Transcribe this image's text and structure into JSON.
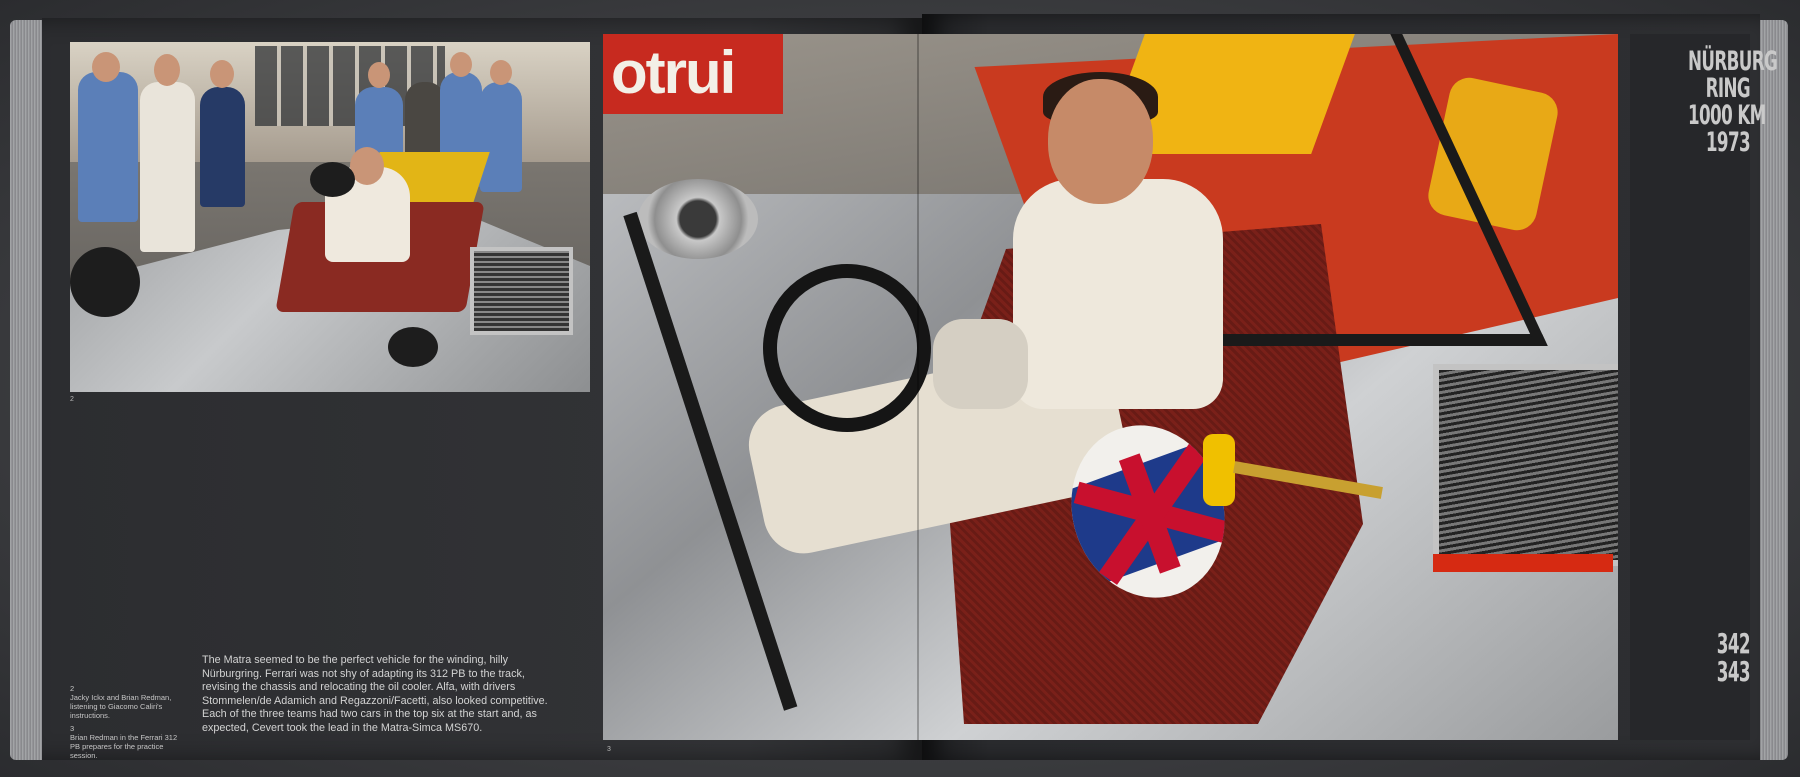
{
  "left_page": {
    "photo_number": "2",
    "captions": [
      {
        "number": "2",
        "text": "Jacky Ickx and Brian Redman, listening to Giacomo Caliri's instructions."
      },
      {
        "number": "3",
        "text": "Brian Redman in the Ferrari 312 PB prepares for the practice session."
      }
    ],
    "body_text": "The Matra seemed to be the perfect vehicle for the winding, hilly Nürburgring. Ferrari was not shy of adapting its 312 PB to the track, revising the chassis and relocating the oil cooler. Alfa, with drivers Stommelen/de Adamich and Regazzoni/Facetti, also looked competitive. Each of the three teams had two cars in the top six at the start and, as expected, Cevert took the lead in the Matra-Simca MS670."
  },
  "spread_photo": {
    "photo_number": "3",
    "sign_text": "otrui"
  },
  "right_page": {
    "chapter_title_lines": [
      "NÜRBURG",
      "RING",
      "1000 KM",
      "1973"
    ],
    "page_numbers": [
      "342",
      "343"
    ]
  },
  "colors": {
    "page_dark": "#2e2f32",
    "text_light": "#c9c9c9",
    "ferrari_red": "#c93a1f",
    "yellow": "#f0b413"
  }
}
